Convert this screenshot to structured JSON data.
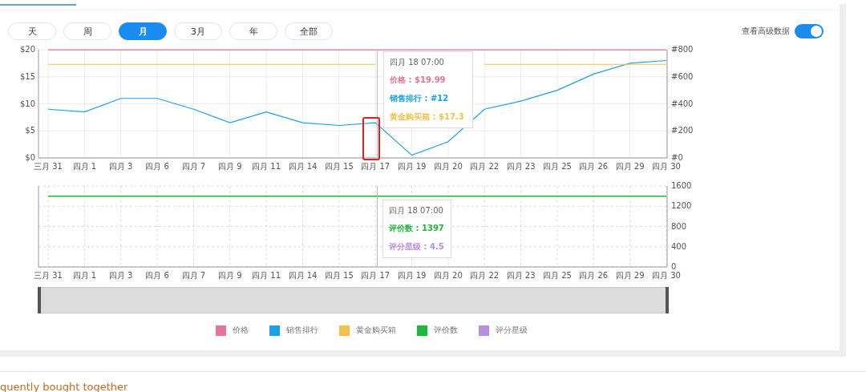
{
  "ranges": [
    {
      "label": "天",
      "selected": false
    },
    {
      "label": "周",
      "selected": false
    },
    {
      "label": "月",
      "selected": true
    },
    {
      "label": "3月",
      "selected": false
    },
    {
      "label": "年",
      "selected": false
    },
    {
      "label": "全部",
      "selected": false
    }
  ],
  "raw_toggle": {
    "label": "查看高级数据",
    "on": true
  },
  "price_chart": {
    "chart_data": {
      "type": "line",
      "grid": true,
      "categories": [
        "三月 31",
        "四月 1",
        "四月 3",
        "四月 6",
        "四月 7",
        "四月 9",
        "四月 11",
        "四月 14",
        "四月 15",
        "四月 17",
        "四月 19",
        "四月 20",
        "四月 22",
        "四月 23",
        "四月 25",
        "四月 26",
        "四月 29",
        "四月 30"
      ],
      "ylim": [
        0,
        20
      ],
      "yticks": [
        {
          "value": 0,
          "label": "$0"
        },
        {
          "value": 5,
          "label": "$5"
        },
        {
          "value": 10,
          "label": "$10"
        },
        {
          "value": 15,
          "label": "$15"
        },
        {
          "value": 20,
          "label": "$20"
        }
      ],
      "y2lim": [
        0,
        800
      ],
      "y2ticks": [
        {
          "value": 0,
          "label": "#0"
        },
        {
          "value": 200,
          "label": "#200"
        },
        {
          "value": 400,
          "label": "#400"
        },
        {
          "value": 600,
          "label": "#600"
        },
        {
          "value": 800,
          "label": "#800"
        }
      ],
      "series": [
        {
          "name": "价格",
          "color": "#e8729c",
          "values": [
            19.99,
            19.99,
            19.99,
            19.99,
            19.99,
            19.99,
            19.99,
            19.99,
            19.99,
            19.99,
            19.99,
            19.99,
            19.99,
            19.99,
            19.99,
            19.99,
            19.99,
            19.99
          ]
        },
        {
          "name": "销售排行",
          "color": "#1aa1e6",
          "axis": "y2",
          "values": [
            360,
            340,
            440,
            440,
            360,
            260,
            340,
            260,
            240,
            260,
            20,
            120,
            360,
            420,
            500,
            620,
            700,
            720
          ]
        },
        {
          "name": "黄金购买箱",
          "color": "#f4c04b",
          "values": [
            17.3,
            17.3,
            17.3,
            17.3,
            17.3,
            17.3,
            17.3,
            17.3,
            17.3,
            17.3,
            null,
            null,
            17.3,
            17.3,
            17.3,
            17.3,
            17.3,
            17.3
          ]
        }
      ]
    },
    "tooltip": {
      "title": "四月 18 07:00",
      "lines": [
        "价格 : $19.99",
        "销售排行 : #12",
        "黄金购买箱 : $17.3"
      ]
    }
  },
  "review_chart": {
    "chart_data": {
      "type": "line",
      "grid": true,
      "categories": [
        "三月 31",
        "四月 1",
        "四月 3",
        "四月 6",
        "四月 7",
        "四月 9",
        "四月 11",
        "四月 14",
        "四月 15",
        "四月 17",
        "四月 19",
        "四月 20",
        "四月 22",
        "四月 23",
        "四月 25",
        "四月 26",
        "四月 29",
        "四月 30"
      ],
      "ylim": [
        0,
        1600
      ],
      "yticks": [
        0,
        400,
        800,
        1200,
        1600
      ],
      "series": [
        {
          "name": "评价数",
          "color": "#1fb83a",
          "values": [
            1397,
            1397,
            1397,
            1397,
            1397,
            1397,
            1397,
            1397,
            1397,
            1397,
            1397,
            1397,
            1397,
            1397,
            1397,
            1397,
            1397,
            1397
          ]
        }
      ]
    },
    "tooltip": {
      "title": "四月 18 07:00",
      "lines": [
        "评价数 : 1397",
        "评分星级 : 4.5"
      ]
    }
  },
  "zoom_slider": {
    "level": 1
  },
  "extra_legend": [
    {
      "label": "评分星级",
      "color": "#b98ee0"
    }
  ],
  "section_heading": "quently bought together"
}
